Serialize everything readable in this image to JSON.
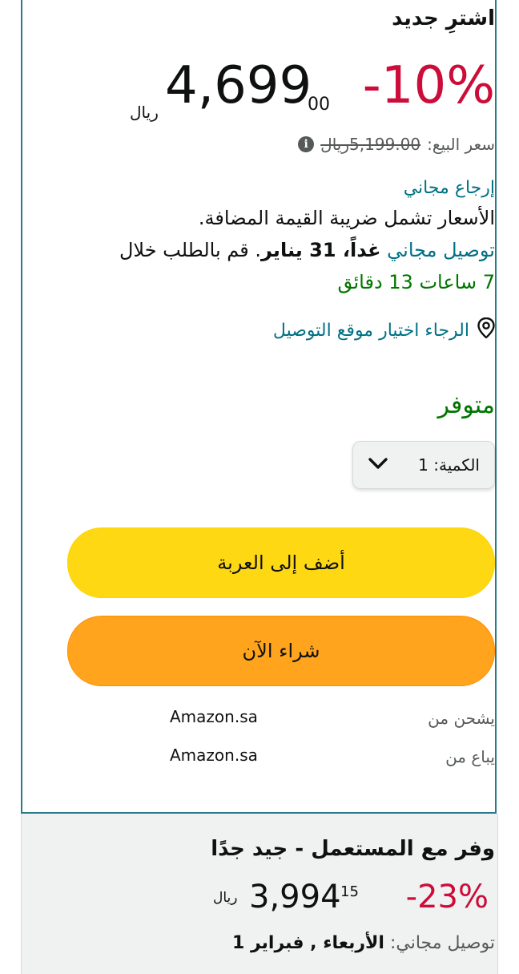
{
  "offer": {
    "title": "اشترِ جديد",
    "discount": "-10%",
    "price_whole": "4,699",
    "price_fraction": "00",
    "currency": "ريال",
    "was_label": "سعر البيع:",
    "was_price": "5,199.00ريال",
    "return_text": "إرجاع مجاني",
    "vat_text": "الأسعار تشمل ضريبة القيمة المضافة.",
    "delivery_free": "توصيل مجاني",
    "delivery_date": "غداً، 31 يناير",
    "order_within_prefix": ". قم بالطلب خلال",
    "order_within_time": "7 ساعات 13 دقائق",
    "location_text": "الرجاء اختيار موقع التوصيل",
    "availability": "متوفر",
    "quantity_label": "الكمية: 1",
    "add_to_cart": "أضف إلى العربة",
    "buy_now": "شراء الآن",
    "ships_from_label": "يشحن من",
    "ships_from_value": "Amazon.sa",
    "sold_by_label": "يباع من",
    "sold_by_value": "Amazon.sa"
  },
  "used_offer": {
    "title": "وفر مع المستعمل - جيد جدًا",
    "discount": "-23%",
    "price_whole": "3,994",
    "price_fraction": "15",
    "currency": "ريال",
    "delivery_label": "توصيل مجاني:",
    "delivery_date": "الأربعاء , فبراير 1"
  },
  "colors": {
    "deal_red": "#cc0c39",
    "link_teal": "#007185",
    "in_stock_green": "#007600",
    "cart_yellow": "#ffd814",
    "buy_orange": "#ffa41c"
  },
  "icons": [
    "info-icon",
    "location-pin-icon",
    "chevron-down-icon"
  ]
}
